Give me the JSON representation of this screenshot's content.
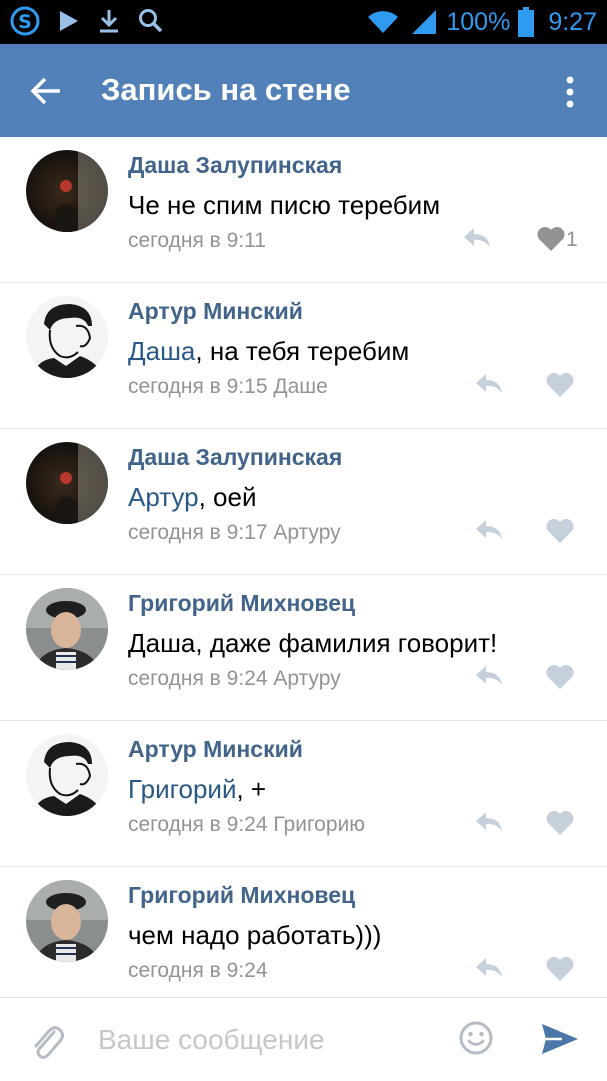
{
  "status_bar": {
    "battery_percent": "100%",
    "time": "9:27",
    "icons": [
      "s-app-icon",
      "play-icon",
      "download-icon",
      "search-icon",
      "wifi-icon",
      "signal-icon",
      "battery-icon"
    ]
  },
  "header": {
    "title": "Запись на стене",
    "back_icon": "arrow-left-icon",
    "menu_icon": "more-vertical-icon"
  },
  "comments": [
    {
      "author": "Даша Залупинская",
      "mention": "",
      "text": "Че не спим писю теребим",
      "meta": "сегодня в 9:11",
      "likes": "1",
      "avatar": "dark-avatar"
    },
    {
      "author": "Артур Минский",
      "mention": "Даша",
      "text": ", на тебя теребим",
      "meta": "сегодня в 9:15 Даше",
      "likes": "",
      "avatar": "sketch-avatar"
    },
    {
      "author": "Даша Залупинская",
      "mention": "Артур",
      "text": ", оей",
      "meta": "сегодня в 9:17 Артуру",
      "likes": "",
      "avatar": "dark-avatar"
    },
    {
      "author": "Григорий Михновец",
      "mention": "",
      "text": "Даша, даже фамилия говорит!",
      "meta": "сегодня в 9:24 Артуру",
      "likes": "",
      "avatar": "photo-avatar"
    },
    {
      "author": "Артур Минский",
      "mention": "Григорий",
      "text": ", +",
      "meta": "сегодня в 9:24 Григорию",
      "likes": "",
      "avatar": "sketch-avatar"
    },
    {
      "author": "Григорий Михновец",
      "mention": "",
      "text": "чем надо работать)))",
      "meta": "сегодня в 9:24",
      "likes": "",
      "avatar": "photo-avatar"
    }
  ],
  "composer": {
    "placeholder": "Ваше сообщение"
  },
  "colors": {
    "header_bg": "#5181b8",
    "author": "#42648b",
    "mention": "#2a5885",
    "meta": "#939393",
    "send": "#4a76a8"
  }
}
